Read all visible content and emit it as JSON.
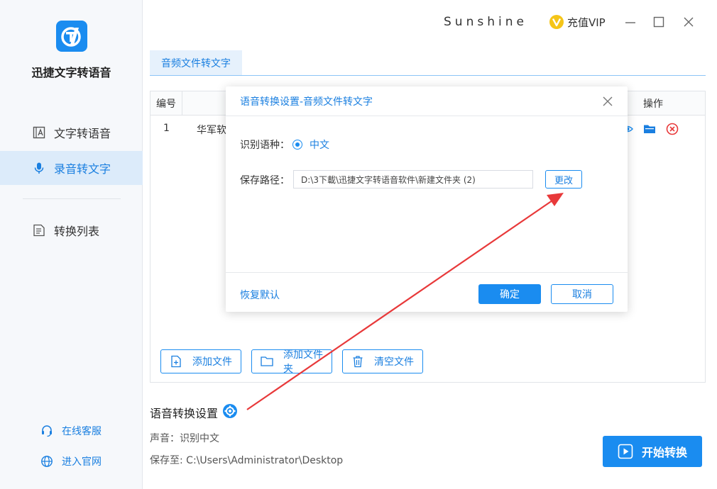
{
  "app": {
    "name": "迅捷文字转语音",
    "brand": "Sunshine",
    "vip_label": "充值VIP"
  },
  "sidebar": {
    "items": [
      {
        "label": "文字转语音"
      },
      {
        "label": "录音转文字"
      },
      {
        "label": "转换列表"
      }
    ],
    "links": [
      {
        "label": "在线客服"
      },
      {
        "label": "进入官网"
      }
    ]
  },
  "tabs": [
    {
      "label": "音频文件转文字"
    }
  ],
  "table": {
    "headers": {
      "num": "编号",
      "op": "操作"
    },
    "rows": [
      {
        "index": "1",
        "name": "华军软"
      }
    ]
  },
  "buttons": {
    "add_file": "添加文件",
    "add_folder": "添加文件夹",
    "clear_files": "清空文件",
    "start": "开始转换"
  },
  "settings": {
    "title": "语音转换设置",
    "voice_line": "声音：识别中文",
    "save_line": "保存至: C:\\Users\\Administrator\\Desktop"
  },
  "dialog": {
    "title": "语音转换设置-音频文件转文字",
    "lang_label": "识别语种：",
    "lang_value": "中文",
    "path_label": "保存路径：",
    "path_value": "D:\\3下載\\迅捷文字转语音软件\\新建文件夹 (2)",
    "change_label": "更改",
    "restore_label": "恢复默认",
    "ok_label": "确定",
    "cancel_label": "取消"
  },
  "colors": {
    "accent": "#1a8cf0",
    "annotation_arrow": "#e8393a",
    "delete_icon": "#e8393a",
    "vip_icon": "#f5c518"
  }
}
